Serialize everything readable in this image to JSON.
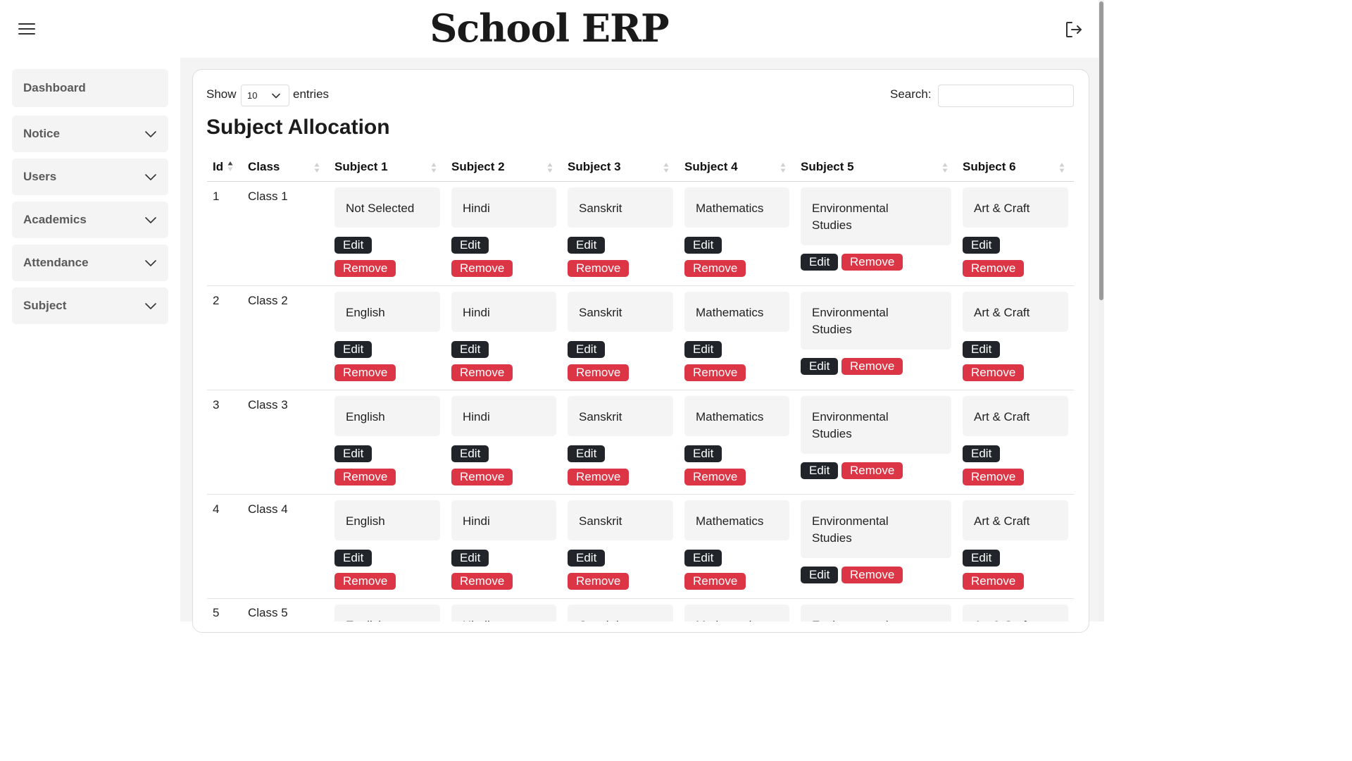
{
  "header": {
    "title": "School ERP"
  },
  "sidebar": {
    "items": [
      {
        "label": "Dashboard"
      },
      {
        "label": "Notice"
      },
      {
        "label": "Users"
      },
      {
        "label": "Academics"
      },
      {
        "label": "Attendance"
      },
      {
        "label": "Subject"
      }
    ]
  },
  "controls": {
    "show_label": "Show",
    "entries_value": "10",
    "entries_label": "entries",
    "search_label": "Search:",
    "search_value": ""
  },
  "page_title": "Subject Allocation",
  "table": {
    "columns": [
      "Id",
      "Class",
      "Subject 1",
      "Subject 2",
      "Subject 3",
      "Subject 4",
      "Subject 5",
      "Subject 6"
    ],
    "edit_label": "Edit",
    "remove_label": "Remove",
    "rows": [
      {
        "id": "1",
        "class": "Class 1",
        "subjects": [
          "Not Selected",
          "Hindi",
          "Sanskrit",
          "Mathematics",
          "Environmental Studies",
          "Art & Craft"
        ]
      },
      {
        "id": "2",
        "class": "Class 2",
        "subjects": [
          "English",
          "Hindi",
          "Sanskrit",
          "Mathematics",
          "Environmental Studies",
          "Art & Craft"
        ]
      },
      {
        "id": "3",
        "class": "Class 3",
        "subjects": [
          "English",
          "Hindi",
          "Sanskrit",
          "Mathematics",
          "Environmental Studies",
          "Art & Craft"
        ]
      },
      {
        "id": "4",
        "class": "Class 4",
        "subjects": [
          "English",
          "Hindi",
          "Sanskrit",
          "Mathematics",
          "Environmental Studies",
          "Art & Craft"
        ]
      },
      {
        "id": "5",
        "class": "Class 5",
        "subjects": [
          "English",
          "Hindi",
          "Sanskrit",
          "Mathematics",
          "Environmental Studies",
          "Art & Craft"
        ]
      }
    ]
  },
  "colors": {
    "edit": "#212529",
    "remove": "#dc3545",
    "panel": "#f4f4f4"
  },
  "icons": {
    "menu": "hamburger-icon",
    "logout": "logout-icon",
    "expand": "chevron-down-icon",
    "sort": "sort-icon"
  }
}
